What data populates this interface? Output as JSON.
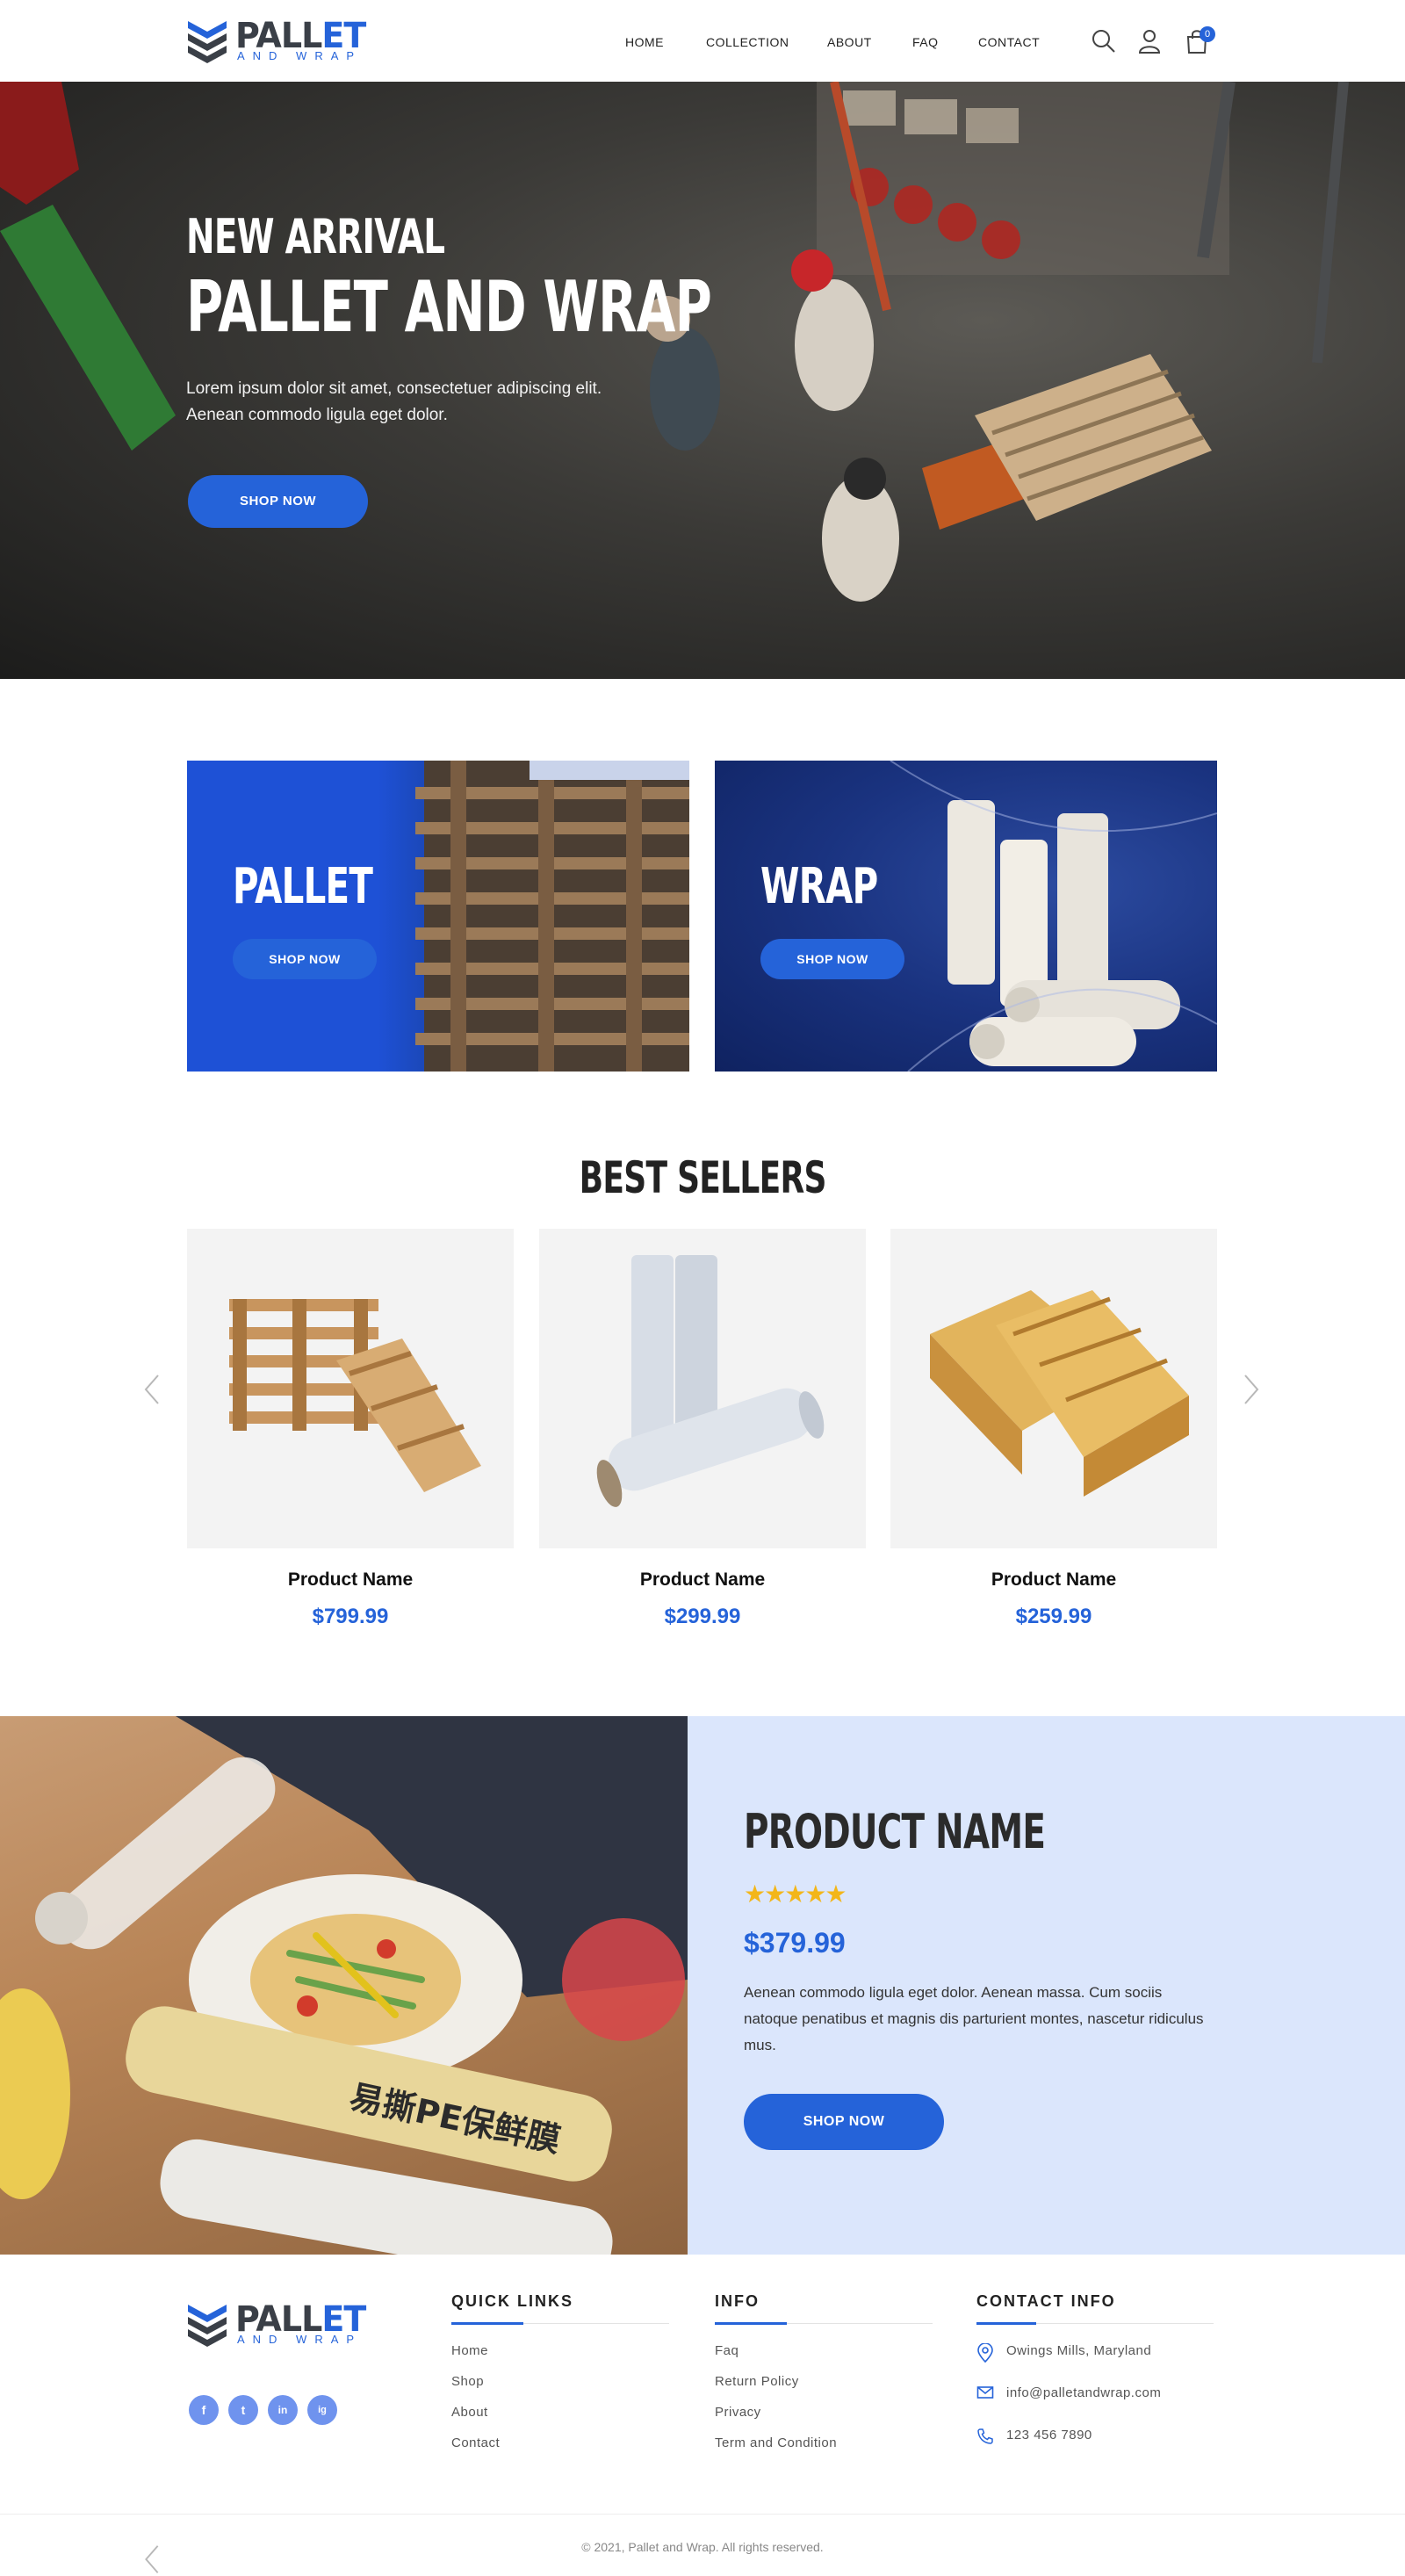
{
  "brand": {
    "name_dark": "PALL",
    "name_accent": "ET",
    "tagline": "AND WRAP"
  },
  "nav": {
    "items": [
      "HOME",
      "COLLECTION",
      "ABOUT",
      "FAQ",
      "CONTACT"
    ],
    "cart_count": "0"
  },
  "hero": {
    "eyebrow": "NEW ARRIVAL",
    "title": "PALLET AND WRAP",
    "text": "Lorem ipsum dolor sit amet, consectetuer adipiscing elit. Aenean commodo ligula eget dolor.",
    "button": "SHOP NOW"
  },
  "categories": [
    {
      "title": "PALLET",
      "button": "SHOP NOW"
    },
    {
      "title": "WRAP",
      "button": "SHOP NOW"
    }
  ],
  "best_sellers": {
    "title": "BEST SELLERS",
    "products": [
      {
        "name": "Product Name",
        "price": "$799.99"
      },
      {
        "name": "Product Name",
        "price": "$299.99"
      },
      {
        "name": "Product Name",
        "price": "$259.99"
      }
    ]
  },
  "feature": {
    "title": "PRODUCT NAME",
    "rating": 5,
    "price": "$379.99",
    "text": "Aenean commodo ligula eget dolor. Aenean massa. Cum sociis natoque penatibus et magnis dis parturient montes, nascetur ridiculus mus.",
    "button": "SHOP NOW",
    "package_text": "易撕PE保鲜膜"
  },
  "footer": {
    "quick_links": {
      "title": "QUICK LINKS",
      "items": [
        "Home",
        "Shop",
        "About",
        "Contact"
      ]
    },
    "info": {
      "title": "INFO",
      "items": [
        "Faq",
        "Return Policy",
        "Privacy",
        "Term and Condition"
      ]
    },
    "contact": {
      "title": "CONTACT INFO",
      "address": "Owings Mills, Maryland",
      "email": "info@palletandwrap.com",
      "phone": "123 456 7890"
    },
    "social": [
      "f",
      "t",
      "in",
      "ig"
    ],
    "copyright": "© 2021, Pallet and Wrap. All rights reserved."
  },
  "colors": {
    "accent": "#2563d9",
    "feature_bg": "#dbe6fc",
    "star": "#f3b619"
  }
}
